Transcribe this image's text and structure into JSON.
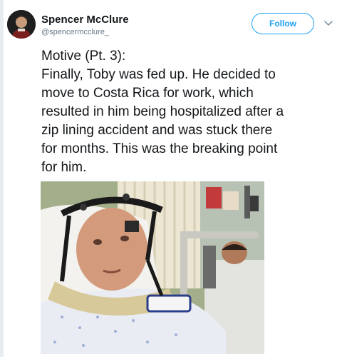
{
  "tweet": {
    "author_name": "Spencer McClure",
    "author_handle": "@spencermcclure_",
    "follow_label": "Follow",
    "text_lines": [
      "Motive (Pt. 3):",
      "Finally, Toby was fed up. He decided to",
      "move to Costa Rica for work, which",
      "resulted in him being hospitalized after a",
      "zip lining accident and was stuck there",
      "for months. This was the breaking point",
      "for him."
    ]
  },
  "icons": {
    "avatar": "avatar",
    "more": "chevron-down-icon"
  },
  "colors": {
    "accent": "#1da1f2",
    "name": "#14171a",
    "secondary": "#657786"
  }
}
